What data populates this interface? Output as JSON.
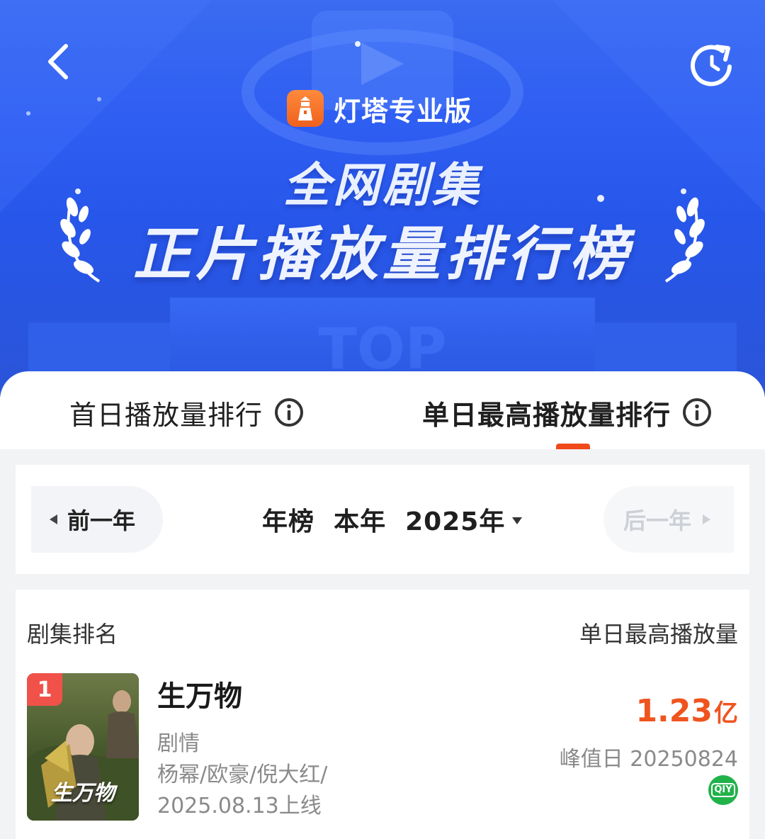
{
  "header": {
    "brand_name": "灯塔专业版",
    "title_line1": "全网剧集",
    "title_line2": "正片播放量排行榜"
  },
  "tabs": [
    {
      "label": "首日播放量排行",
      "active": false
    },
    {
      "label": "单日最高播放量排行",
      "active": true
    }
  ],
  "year_selector": {
    "prev_label": "前一年",
    "current_label": "年榜  本年  2025年",
    "next_label": "后一年",
    "next_disabled": true
  },
  "list": {
    "col_left": "剧集排名",
    "col_right": "单日最高播放量",
    "rows": [
      {
        "rank": "1",
        "title": "生万物",
        "poster_text": "生万物",
        "genre": "剧情",
        "cast": "杨幂/欧豪/倪大红/",
        "release": "2025.08.13上线",
        "value": "1.23",
        "unit": "亿",
        "peak": "峰值日 20250824",
        "platform_icon": "iqiyi-icon",
        "platform_text": "QIY"
      }
    ]
  },
  "colors": {
    "accent": "#f04a1a",
    "hero_blue": "#2f5ef2",
    "rank_badge": "#f0524a",
    "platform_green": "#21b24a"
  }
}
